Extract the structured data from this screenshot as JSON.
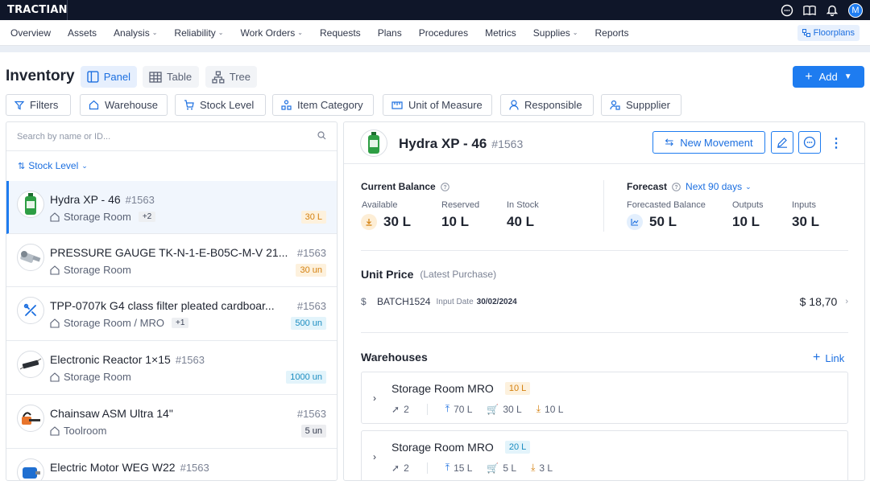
{
  "topbar": {
    "logo": "TRACTIAN",
    "avatar": "M"
  },
  "nav": {
    "items": [
      {
        "label": "Overview",
        "dropdown": false
      },
      {
        "label": "Assets",
        "dropdown": false
      },
      {
        "label": "Analysis",
        "dropdown": true
      },
      {
        "label": "Reliability",
        "dropdown": true
      },
      {
        "label": "Work Orders",
        "dropdown": true
      },
      {
        "label": "Requests",
        "dropdown": false
      },
      {
        "label": "Plans",
        "dropdown": false
      },
      {
        "label": "Procedures",
        "dropdown": false
      },
      {
        "label": "Metrics",
        "dropdown": false
      },
      {
        "label": "Supplies",
        "dropdown": true
      },
      {
        "label": "Reports",
        "dropdown": false
      }
    ],
    "floorplans": "Floorplans"
  },
  "page": {
    "title": "Inventory",
    "views": {
      "panel": "Panel",
      "table": "Table",
      "tree": "Tree"
    },
    "add": "Add"
  },
  "filters": {
    "filters": "Filters",
    "warehouse": "Warehouse",
    "stock_level": "Stock Level",
    "item_category": "Item Category",
    "unit_of_measure": "Unit of Measure",
    "responsible": "Responsible",
    "supplier": "Suppplier"
  },
  "list": {
    "search_placeholder": "Search by name or ID...",
    "sort_label": "Stock Level",
    "items": [
      {
        "name": "Hydra XP - 46",
        "id": "#1563",
        "location": "Storage Room",
        "extra": "+2",
        "qty": "30 L"
      },
      {
        "name": "PRESSURE GAUGE TK-N-1-E-B05C-M-V 21...",
        "id": "#1563",
        "location": "Storage Room",
        "extra": "",
        "qty": "30 un"
      },
      {
        "name": "TPP-0707k G4 class filter pleated cardboar...",
        "id": "#1563",
        "location": "Storage Room / MRO",
        "extra": "+1",
        "qty": "500 un"
      },
      {
        "name": "Electronic Reactor 1×15",
        "id": "#1563",
        "location": "Storage Room",
        "extra": "",
        "qty": "1000 un"
      },
      {
        "name": "Chainsaw ASM Ultra 14\"",
        "id": "#1563",
        "location": "Toolroom",
        "extra": "",
        "qty": "5 un"
      },
      {
        "name": "Electric Motor WEG W22",
        "id": "#1563",
        "location": "",
        "extra": "",
        "qty": ""
      }
    ]
  },
  "detail": {
    "name": "Hydra XP - 46",
    "id": "#1563",
    "new_movement": "New Movement",
    "current_balance": {
      "title": "Current Balance",
      "available_label": "Available",
      "available": "30 L",
      "reserved_label": "Reserved",
      "reserved": "10 L",
      "in_stock_label": "In Stock",
      "in_stock": "40 L"
    },
    "forecast": {
      "title": "Forecast",
      "period": "Next 90 days",
      "forecasted_label": "Forecasted Balance",
      "forecasted": "50 L",
      "outputs_label": "Outputs",
      "outputs": "10 L",
      "inputs_label": "Inputs",
      "inputs": "30 L"
    },
    "unit_price": {
      "title": "Unit Price",
      "subtitle": "(Latest Purchase)",
      "currency_symbol": "$",
      "batch": "BATCH1524",
      "input_date_label": "Input Date",
      "input_date": "30/02/2024",
      "price": "$ 18,70"
    },
    "warehouses": {
      "title": "Warehouses",
      "link": "Link",
      "cards": [
        {
          "name": "Storage Room MRO",
          "badge": "10 L",
          "pins": "2",
          "max": "70 L",
          "reorder": "30 L",
          "min": "10 L"
        },
        {
          "name": "Storage Room MRO",
          "badge": "20 L",
          "pins": "2",
          "max": "15 L",
          "reorder": "5 L",
          "min": "3 L"
        }
      ]
    }
  },
  "colors": {
    "accent": "#1e7cf0",
    "topbar": "#0f1629",
    "orange": "#d4800f",
    "teal": "#1b8cc0"
  }
}
